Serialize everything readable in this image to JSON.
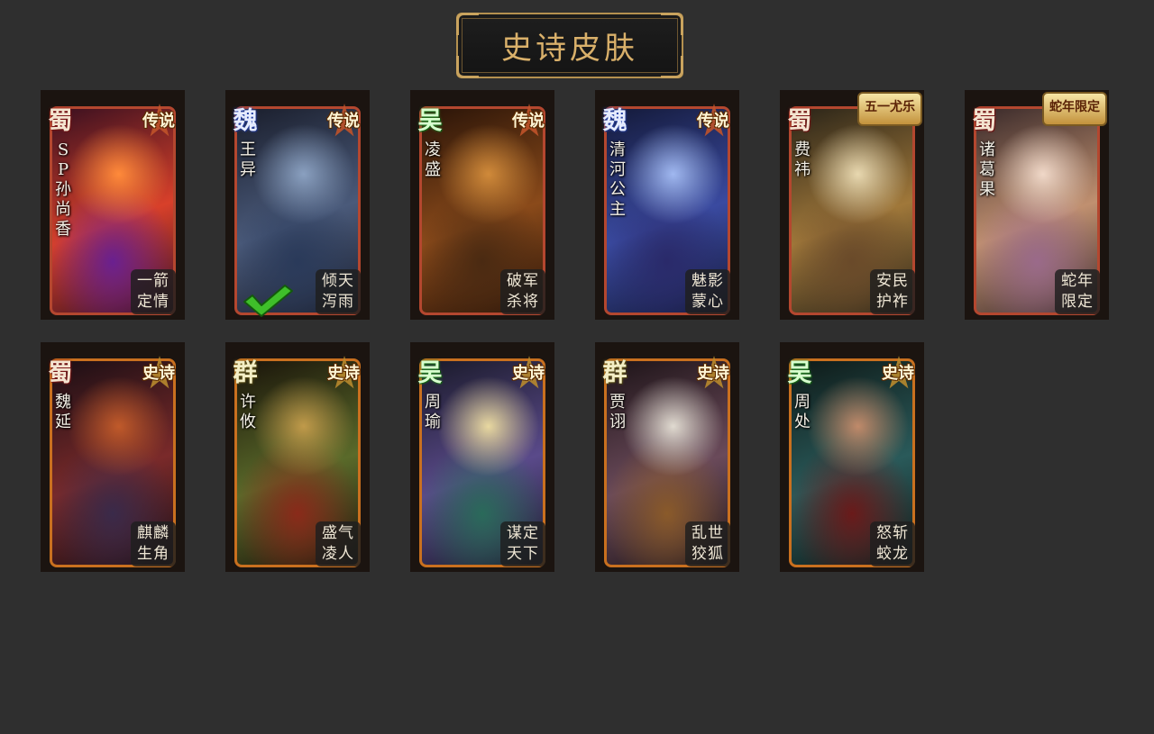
{
  "title": "史诗皮肤",
  "cards": [
    {
      "faction": "蜀",
      "faction_class": "shu",
      "rarity": "传说",
      "rarity_class": "legend",
      "hero": "SP孙尚香",
      "skin": [
        "一箭",
        "定情"
      ],
      "selected": false,
      "art": [
        "#3a1020",
        "#d8402a",
        "#ff8a3a",
        "#6a2090"
      ]
    },
    {
      "faction": "魏",
      "faction_class": "wei",
      "rarity": "传说",
      "rarity_class": "legend",
      "hero": "王异",
      "skin": [
        "倾天",
        "泻雨"
      ],
      "selected": true,
      "art": [
        "#1a1e2c",
        "#4a5a7a",
        "#8aa0c0",
        "#2a3a5a"
      ]
    },
    {
      "faction": "吴",
      "faction_class": "wu",
      "rarity": "传说",
      "rarity_class": "legend",
      "hero": "凌盛",
      "skin": [
        "破军",
        "杀将"
      ],
      "selected": false,
      "art": [
        "#2a1408",
        "#8a4a1a",
        "#d08a3a",
        "#4a2a12"
      ]
    },
    {
      "faction": "魏",
      "faction_class": "wei",
      "rarity": "传说",
      "rarity_class": "legend",
      "hero": "清河公主",
      "skin": [
        "魅影",
        "蒙心"
      ],
      "selected": false,
      "art": [
        "#141a3a",
        "#3a4aa0",
        "#a0b8f0",
        "#2a2a6a"
      ]
    },
    {
      "faction": "蜀",
      "faction_class": "shu",
      "rarity": "",
      "rarity_class": "",
      "event": "五一尤乐",
      "hero": "费祎",
      "skin": [
        "安民",
        "护祚"
      ],
      "selected": false,
      "art": [
        "#2a2418",
        "#a0783a",
        "#e8d8b0",
        "#6a4a2a"
      ]
    },
    {
      "faction": "蜀",
      "faction_class": "shu",
      "rarity": "",
      "rarity_class": "",
      "event": "蛇年限定",
      "hero": "诸葛果",
      "skin": [
        "蛇年",
        "限定"
      ],
      "selected": false,
      "art": [
        "#3a2a2a",
        "#c09070",
        "#f0d8c8",
        "#9a6a8a"
      ]
    },
    {
      "faction": "蜀",
      "faction_class": "shu",
      "rarity": "史诗",
      "rarity_class": "epic",
      "hero": "魏延",
      "skin": [
        "麒麟",
        "生角"
      ],
      "selected": false,
      "art": [
        "#1a0e14",
        "#7a2a2a",
        "#c05a2a",
        "#3a2a4a"
      ]
    },
    {
      "faction": "群",
      "faction_class": "qun",
      "rarity": "史诗",
      "rarity_class": "epic",
      "hero": "许攸",
      "skin": [
        "盛气",
        "凌人"
      ],
      "selected": false,
      "art": [
        "#1a140a",
        "#5a6a2a",
        "#c09a4a",
        "#8a2a1a"
      ]
    },
    {
      "faction": "吴",
      "faction_class": "wu",
      "rarity": "史诗",
      "rarity_class": "epic",
      "hero": "周瑜",
      "skin": [
        "谋定",
        "天下"
      ],
      "selected": false,
      "art": [
        "#1a1a2a",
        "#5a4a8a",
        "#e8d8a0",
        "#2a6a5a"
      ]
    },
    {
      "faction": "群",
      "faction_class": "qun",
      "rarity": "史诗",
      "rarity_class": "epic",
      "hero": "贾诩",
      "skin": [
        "乱世",
        "狡狐"
      ],
      "selected": false,
      "art": [
        "#1e1418",
        "#6a4a5a",
        "#e0dad0",
        "#8a5a2a"
      ]
    },
    {
      "faction": "吴",
      "faction_class": "wu",
      "rarity": "史诗",
      "rarity_class": "epic",
      "hero": "周处",
      "skin": [
        "怒斩",
        "蛟龙"
      ],
      "selected": false,
      "art": [
        "#0e1a18",
        "#2a5a5a",
        "#c08a6a",
        "#6a1a1a"
      ]
    }
  ]
}
